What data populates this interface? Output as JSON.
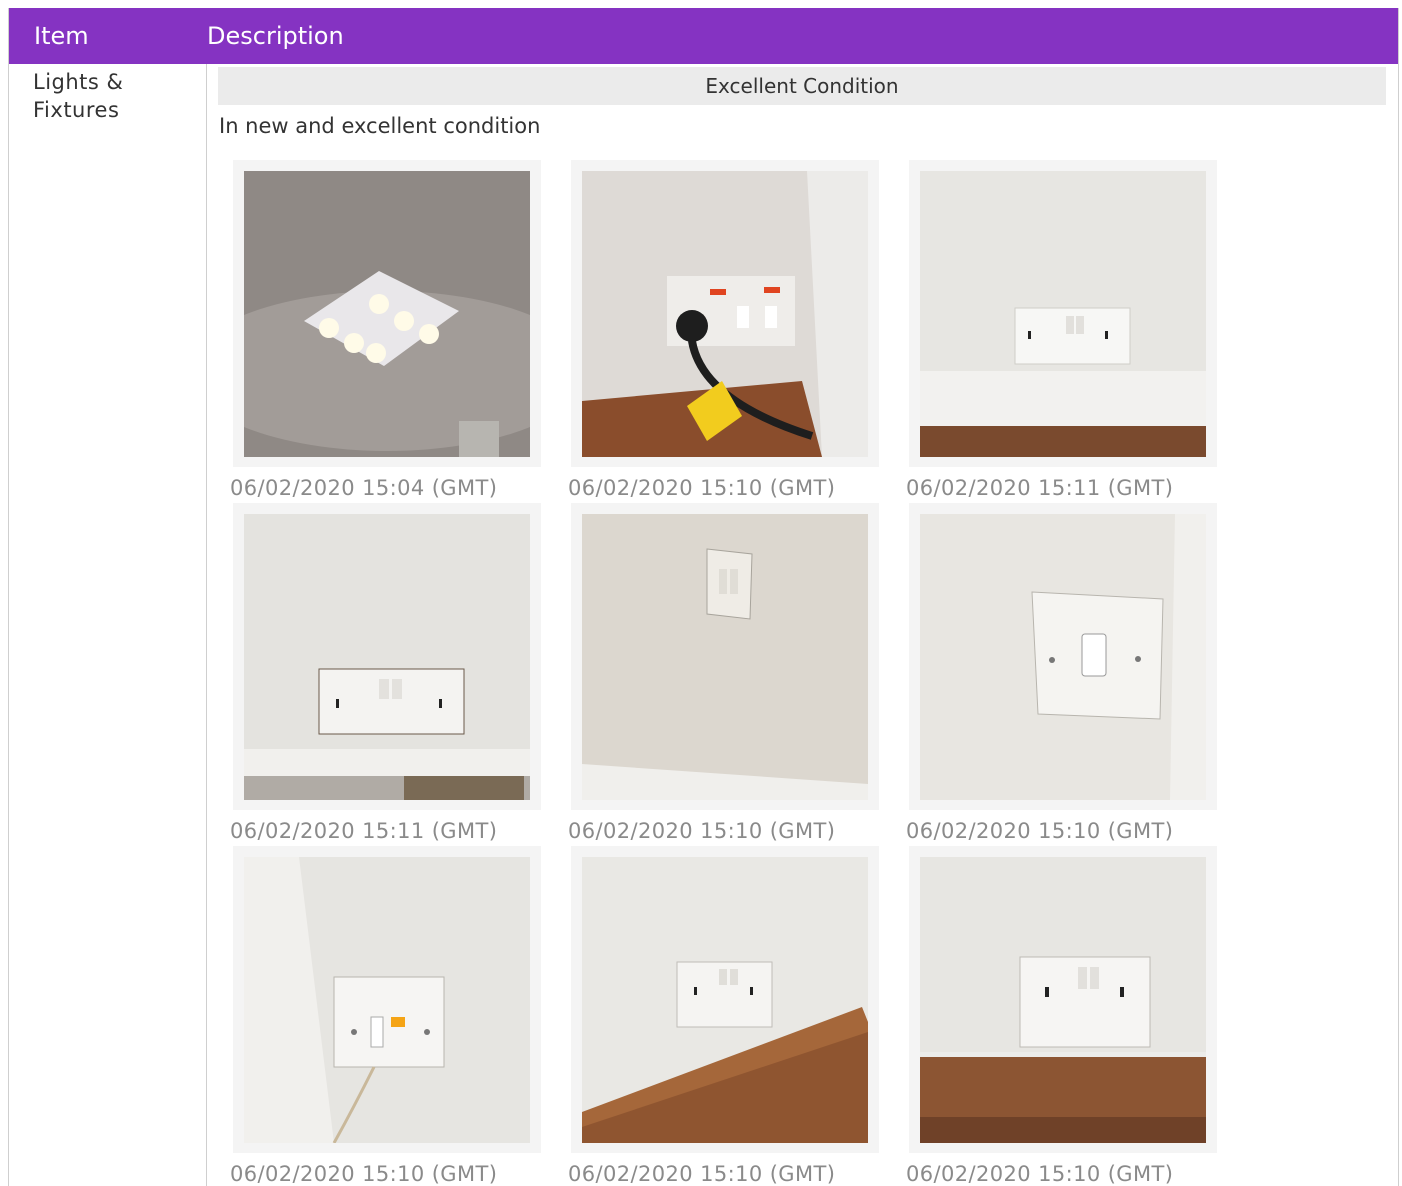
{
  "table": {
    "headers": {
      "item": "Item",
      "description": "Description"
    },
    "accent_color": "#8533c2",
    "row": {
      "item_name": "Lights & Fixtures",
      "condition": "Excellent Condition",
      "condition_text": "In new and excellent condition",
      "photos": [
        {
          "subject": "ceiling-spotlight-fixture",
          "timestamp": "06/02/2020 15:04 (GMT)"
        },
        {
          "subject": "switched-socket-with-plug",
          "timestamp": "06/02/2020 15:10 (GMT)"
        },
        {
          "subject": "double-socket-above-skirting",
          "timestamp": "06/02/2020 15:11 (GMT)"
        },
        {
          "subject": "double-socket-damaged-wall",
          "timestamp": "06/02/2020 15:11 (GMT)"
        },
        {
          "subject": "light-switch-high-on-wall",
          "timestamp": "06/02/2020 15:10 (GMT)"
        },
        {
          "subject": "single-light-switch-corner",
          "timestamp": "06/02/2020 15:10 (GMT)"
        },
        {
          "subject": "fused-spur-with-indicator",
          "timestamp": "06/02/2020 15:10 (GMT)"
        },
        {
          "subject": "double-socket-near-floor",
          "timestamp": "06/02/2020 15:10 (GMT)"
        },
        {
          "subject": "double-socket-above-wood-skirting",
          "timestamp": "06/02/2020 15:10 (GMT)"
        }
      ]
    }
  }
}
